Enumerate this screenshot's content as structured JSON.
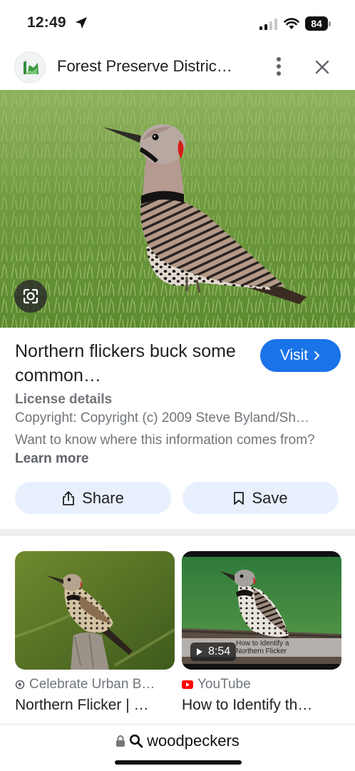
{
  "status_bar": {
    "time": "12:49",
    "battery": "84"
  },
  "header": {
    "site_title": "Forest Preserve Distric…",
    "icons": {
      "logo": "tree-logo-icon",
      "more": "more-vert-icon",
      "close": "close-icon"
    }
  },
  "hero": {
    "alt": "Northern flicker bird standing in grass",
    "lens_icon": "google-lens-icon"
  },
  "result": {
    "title": "Northern flickers buck some common…",
    "visit_label": "Visit",
    "license_heading": "License details",
    "copyright": "Copyright: Copyright (c) 2009 Steve Byland/Sh…",
    "info_text": "Want to know where this information comes from?",
    "learn_more": "Learn more"
  },
  "actions": {
    "share_label": "Share",
    "save_label": "Save"
  },
  "related": [
    {
      "source": "Celebrate Urban B…",
      "title": "Northern Flicker | …"
    },
    {
      "source": "YouTube",
      "title": "How to Identify th…",
      "duration": "8:54",
      "caption": "How to Identify a Northern Flicker"
    }
  ],
  "search": {
    "query": "woodpeckers"
  },
  "colors": {
    "accent": "#1a73e8",
    "chip_bg": "#e8f0fe",
    "youtube_red": "#ff0000"
  }
}
